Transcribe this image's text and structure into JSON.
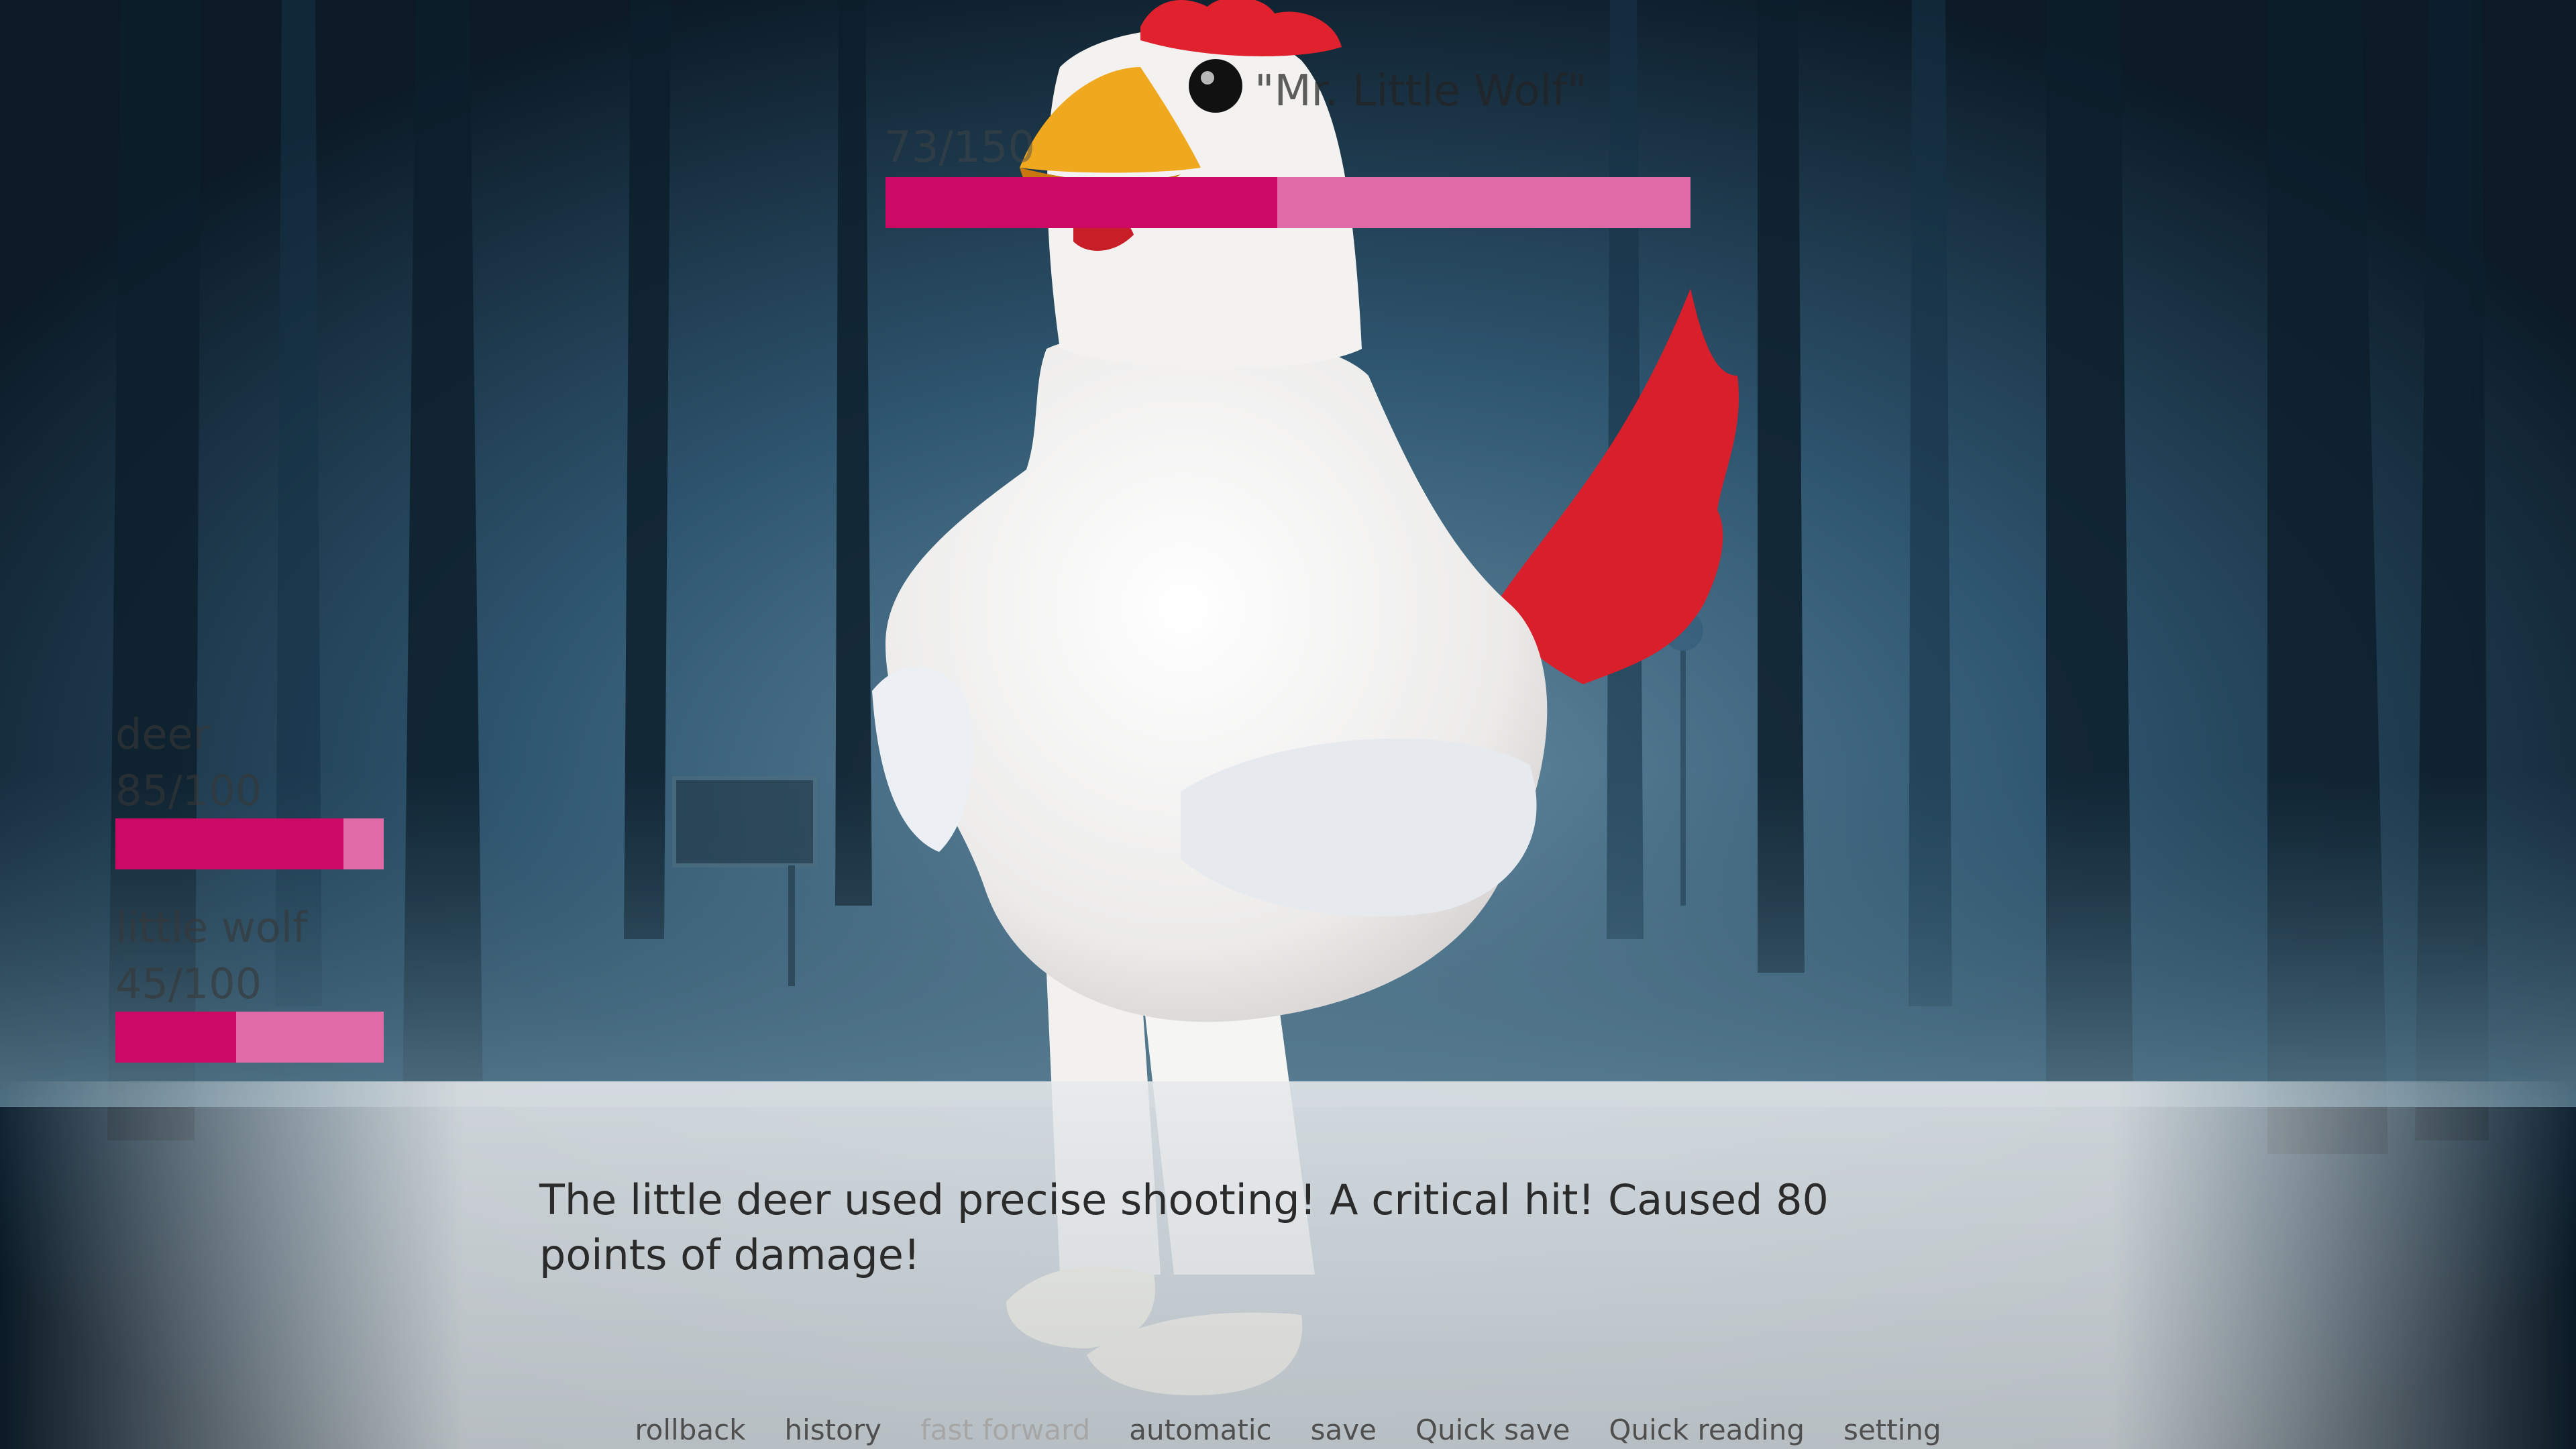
{
  "enemy": {
    "name": "\"Mr. Little Wolf\"",
    "hp_text": "73/150",
    "hp_fraction": 0.487
  },
  "party": [
    {
      "name": "deer",
      "hp_text": "85/100",
      "hp_fraction": 0.85
    },
    {
      "name": "little wolf",
      "hp_text": "45/100",
      "hp_fraction": 0.45
    }
  ],
  "dialogue": {
    "text": "The little deer used precise shooting! A critical hit! Caused 80 points of damage!"
  },
  "quick_menu": {
    "rollback": "rollback",
    "history": "history",
    "fast_forward": "fast forward",
    "automatic": "automatic",
    "save": "save",
    "quick_save": "Quick save",
    "quick_reading": "Quick reading",
    "setting": "setting"
  },
  "colors": {
    "hp_fill": "#cc0a66",
    "hp_track": "#e06aa8",
    "forest_dark": "#0f2231",
    "rooster_comb": "#e0212e"
  }
}
